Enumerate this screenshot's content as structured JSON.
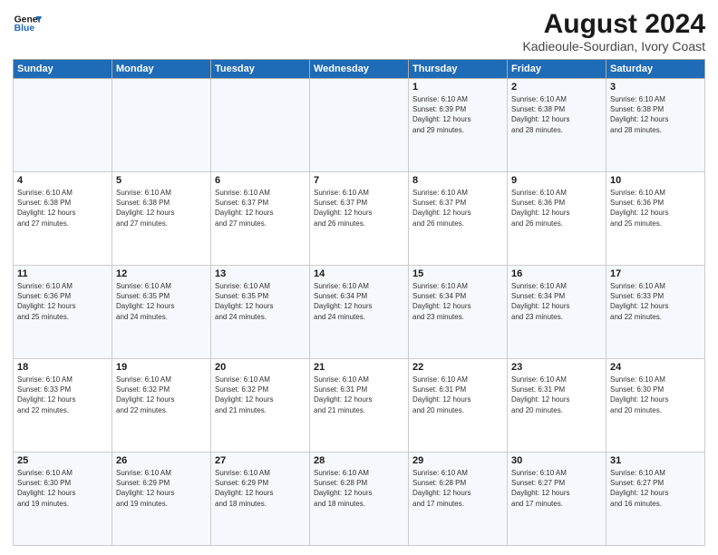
{
  "logo": {
    "line1": "General",
    "line2": "Blue"
  },
  "title": "August 2024",
  "subtitle": "Kadieoule-Sourdian, Ivory Coast",
  "days_header": [
    "Sunday",
    "Monday",
    "Tuesday",
    "Wednesday",
    "Thursday",
    "Friday",
    "Saturday"
  ],
  "weeks": [
    [
      {
        "day": "",
        "info": ""
      },
      {
        "day": "",
        "info": ""
      },
      {
        "day": "",
        "info": ""
      },
      {
        "day": "",
        "info": ""
      },
      {
        "day": "1",
        "info": "Sunrise: 6:10 AM\nSunset: 6:39 PM\nDaylight: 12 hours\nand 29 minutes."
      },
      {
        "day": "2",
        "info": "Sunrise: 6:10 AM\nSunset: 6:38 PM\nDaylight: 12 hours\nand 28 minutes."
      },
      {
        "day": "3",
        "info": "Sunrise: 6:10 AM\nSunset: 6:38 PM\nDaylight: 12 hours\nand 28 minutes."
      }
    ],
    [
      {
        "day": "4",
        "info": "Sunrise: 6:10 AM\nSunset: 6:38 PM\nDaylight: 12 hours\nand 27 minutes."
      },
      {
        "day": "5",
        "info": "Sunrise: 6:10 AM\nSunset: 6:38 PM\nDaylight: 12 hours\nand 27 minutes."
      },
      {
        "day": "6",
        "info": "Sunrise: 6:10 AM\nSunset: 6:37 PM\nDaylight: 12 hours\nand 27 minutes."
      },
      {
        "day": "7",
        "info": "Sunrise: 6:10 AM\nSunset: 6:37 PM\nDaylight: 12 hours\nand 26 minutes."
      },
      {
        "day": "8",
        "info": "Sunrise: 6:10 AM\nSunset: 6:37 PM\nDaylight: 12 hours\nand 26 minutes."
      },
      {
        "day": "9",
        "info": "Sunrise: 6:10 AM\nSunset: 6:36 PM\nDaylight: 12 hours\nand 26 minutes."
      },
      {
        "day": "10",
        "info": "Sunrise: 6:10 AM\nSunset: 6:36 PM\nDaylight: 12 hours\nand 25 minutes."
      }
    ],
    [
      {
        "day": "11",
        "info": "Sunrise: 6:10 AM\nSunset: 6:36 PM\nDaylight: 12 hours\nand 25 minutes."
      },
      {
        "day": "12",
        "info": "Sunrise: 6:10 AM\nSunset: 6:35 PM\nDaylight: 12 hours\nand 24 minutes."
      },
      {
        "day": "13",
        "info": "Sunrise: 6:10 AM\nSunset: 6:35 PM\nDaylight: 12 hours\nand 24 minutes."
      },
      {
        "day": "14",
        "info": "Sunrise: 6:10 AM\nSunset: 6:34 PM\nDaylight: 12 hours\nand 24 minutes."
      },
      {
        "day": "15",
        "info": "Sunrise: 6:10 AM\nSunset: 6:34 PM\nDaylight: 12 hours\nand 23 minutes."
      },
      {
        "day": "16",
        "info": "Sunrise: 6:10 AM\nSunset: 6:34 PM\nDaylight: 12 hours\nand 23 minutes."
      },
      {
        "day": "17",
        "info": "Sunrise: 6:10 AM\nSunset: 6:33 PM\nDaylight: 12 hours\nand 22 minutes."
      }
    ],
    [
      {
        "day": "18",
        "info": "Sunrise: 6:10 AM\nSunset: 6:33 PM\nDaylight: 12 hours\nand 22 minutes."
      },
      {
        "day": "19",
        "info": "Sunrise: 6:10 AM\nSunset: 6:32 PM\nDaylight: 12 hours\nand 22 minutes."
      },
      {
        "day": "20",
        "info": "Sunrise: 6:10 AM\nSunset: 6:32 PM\nDaylight: 12 hours\nand 21 minutes."
      },
      {
        "day": "21",
        "info": "Sunrise: 6:10 AM\nSunset: 6:31 PM\nDaylight: 12 hours\nand 21 minutes."
      },
      {
        "day": "22",
        "info": "Sunrise: 6:10 AM\nSunset: 6:31 PM\nDaylight: 12 hours\nand 20 minutes."
      },
      {
        "day": "23",
        "info": "Sunrise: 6:10 AM\nSunset: 6:31 PM\nDaylight: 12 hours\nand 20 minutes."
      },
      {
        "day": "24",
        "info": "Sunrise: 6:10 AM\nSunset: 6:30 PM\nDaylight: 12 hours\nand 20 minutes."
      }
    ],
    [
      {
        "day": "25",
        "info": "Sunrise: 6:10 AM\nSunset: 6:30 PM\nDaylight: 12 hours\nand 19 minutes."
      },
      {
        "day": "26",
        "info": "Sunrise: 6:10 AM\nSunset: 6:29 PM\nDaylight: 12 hours\nand 19 minutes."
      },
      {
        "day": "27",
        "info": "Sunrise: 6:10 AM\nSunset: 6:29 PM\nDaylight: 12 hours\nand 18 minutes."
      },
      {
        "day": "28",
        "info": "Sunrise: 6:10 AM\nSunset: 6:28 PM\nDaylight: 12 hours\nand 18 minutes."
      },
      {
        "day": "29",
        "info": "Sunrise: 6:10 AM\nSunset: 6:28 PM\nDaylight: 12 hours\nand 17 minutes."
      },
      {
        "day": "30",
        "info": "Sunrise: 6:10 AM\nSunset: 6:27 PM\nDaylight: 12 hours\nand 17 minutes."
      },
      {
        "day": "31",
        "info": "Sunrise: 6:10 AM\nSunset: 6:27 PM\nDaylight: 12 hours\nand 16 minutes."
      }
    ]
  ]
}
